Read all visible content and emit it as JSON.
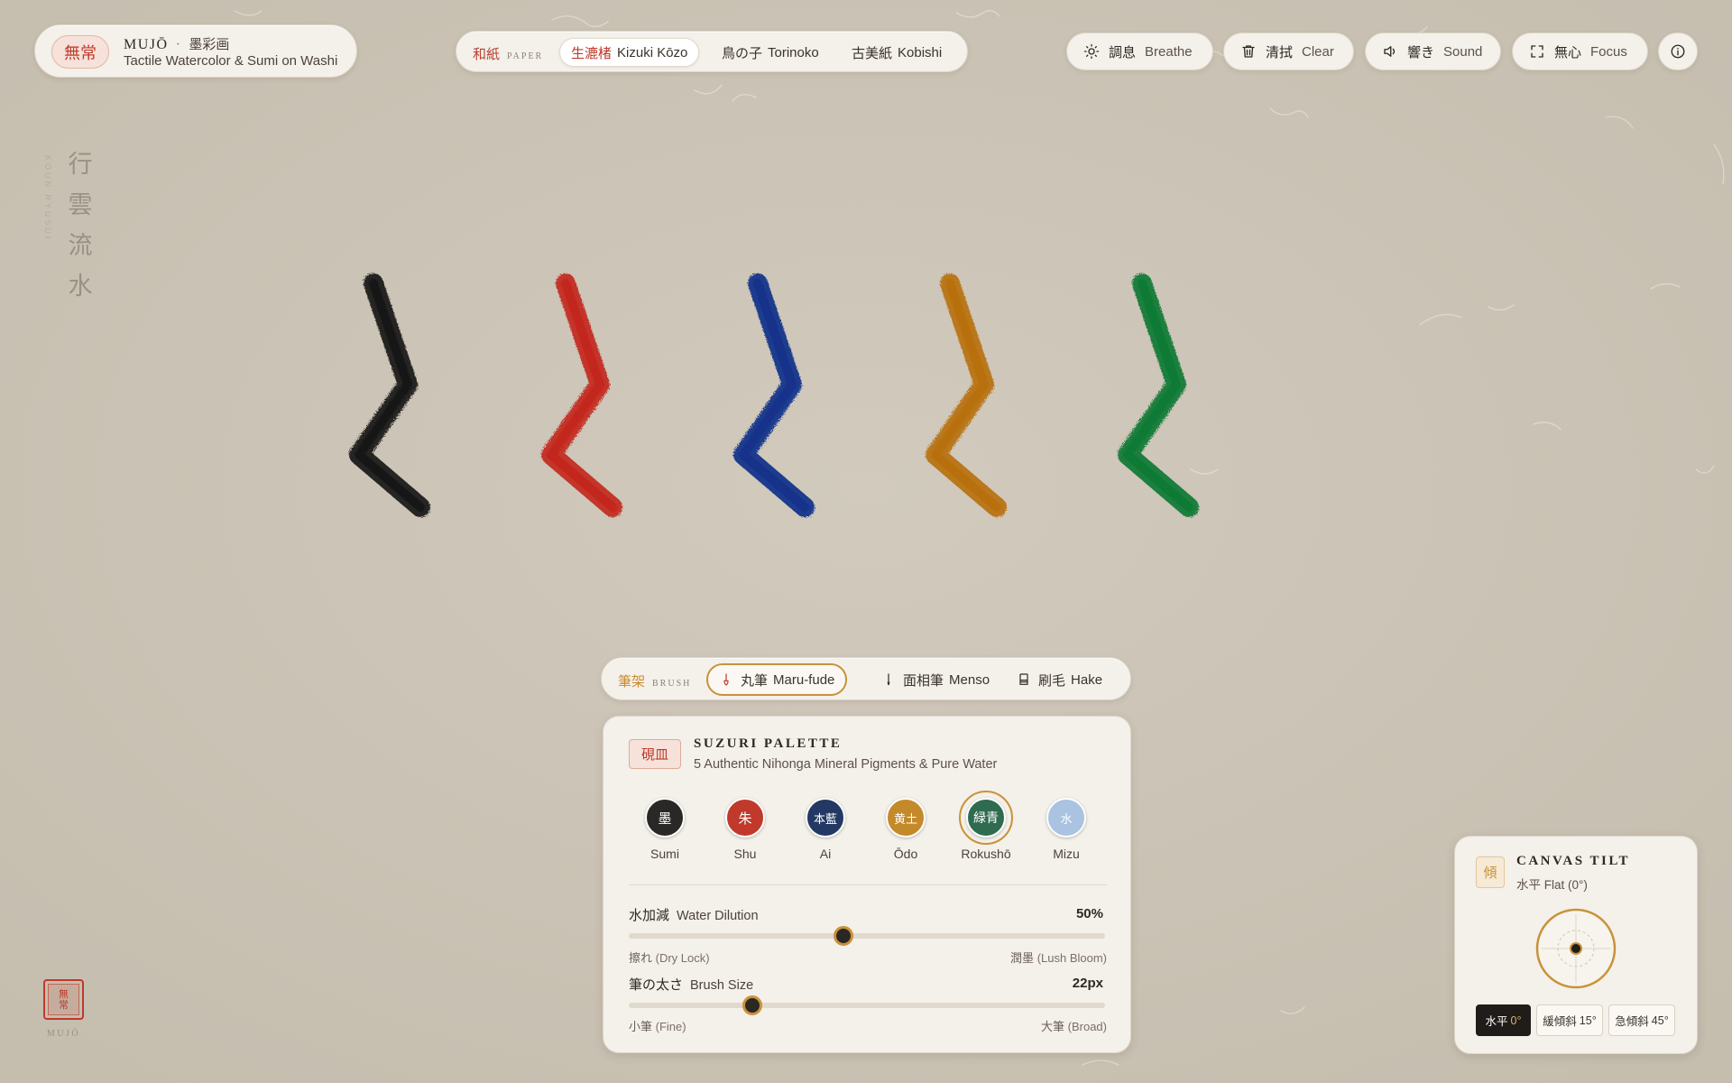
{
  "brand": {
    "seal": "無常",
    "title": "MUJŌ",
    "title_jp": "墨彩画",
    "subtitle": "Tactile Watercolor & Sumi on Washi"
  },
  "paper": {
    "tag_jp": "和紙",
    "tag_en": "PAPER",
    "options": [
      {
        "jp": "生漉楮",
        "en": "Kizuki Kōzo",
        "active": true
      },
      {
        "jp": "鳥の子",
        "en": "Torinoko",
        "active": false
      },
      {
        "jp": "古美紙",
        "en": "Kobishi",
        "active": false
      }
    ]
  },
  "actions": {
    "breathe": {
      "jp": "調息",
      "en": "Breathe",
      "icon": "sun-icon"
    },
    "clear": {
      "jp": "清拭",
      "en": "Clear",
      "icon": "trash-icon"
    },
    "sound": {
      "jp": "響き",
      "en": "Sound",
      "icon": "speaker-icon"
    },
    "focus": {
      "jp": "無心",
      "en": "Focus",
      "icon": "fullscreen-icon"
    },
    "info": {
      "icon": "info-icon"
    }
  },
  "poem": {
    "chars": [
      "行",
      "雲",
      "流",
      "水"
    ],
    "romaji": "KOUN RYUSUI"
  },
  "strokes": [
    {
      "pigment": "Sumi",
      "color": "#161616"
    },
    {
      "pigment": "Shu",
      "color": "#c3261b"
    },
    {
      "pigment": "Ai",
      "color": "#12308a"
    },
    {
      "pigment": "Ōdo",
      "color": "#b8700c"
    },
    {
      "pigment": "Rokushō",
      "color": "#0f7a34"
    }
  ],
  "brush": {
    "tag_jp": "筆架",
    "tag_en": "BRUSH",
    "options": [
      {
        "jp": "丸筆",
        "en": "Maru-fude",
        "icon": "round-brush-icon",
        "active": true
      },
      {
        "jp": "面相筆",
        "en": "Menso",
        "icon": "fine-brush-icon",
        "active": false
      },
      {
        "jp": "刷毛",
        "en": "Hake",
        "icon": "flat-brush-icon",
        "active": false
      }
    ]
  },
  "palette": {
    "badge": "硯皿",
    "title": "SUZURI PALETTE",
    "subtitle": "5 Authentic Nihonga Mineral Pigments & Pure Water",
    "swatches": [
      {
        "kanji": "墨",
        "name": "Sumi",
        "color": "#2a2827",
        "active": false
      },
      {
        "kanji": "朱",
        "name": "Shu",
        "color": "#c0392b",
        "active": false
      },
      {
        "kanji": "本藍",
        "name": "Ai",
        "color": "#233862",
        "active": false
      },
      {
        "kanji": "黄土",
        "name": "Ōdo",
        "color": "#c48a2a",
        "active": false
      },
      {
        "kanji": "緑青",
        "name": "Rokushō",
        "color": "#2f6b4f",
        "active": true
      },
      {
        "kanji": "水",
        "name": "Mizu",
        "color": "#a9c3e0",
        "active": false
      }
    ],
    "water": {
      "jp": "水加減",
      "en": "Water Dilution",
      "value": "50%",
      "level": 0.45,
      "min_jp": "擦れ",
      "min_en": "(Dry Lock)",
      "max_jp": "潤墨",
      "max_en": "(Lush Bloom)"
    },
    "size": {
      "jp": "筆の太さ",
      "en": "Brush Size",
      "value": "22px",
      "level": 0.26,
      "min_jp": "小筆",
      "min_en": "(Fine)",
      "max_jp": "大筆",
      "max_en": "(Broad)"
    }
  },
  "tilt": {
    "badge": "傾",
    "title": "CANVAS TILT",
    "status": "水平 Flat (0°)",
    "options": [
      {
        "jp": "水平",
        "deg": "0°",
        "active": true
      },
      {
        "jp": "緩傾斜",
        "deg": "15°",
        "active": false
      },
      {
        "jp": "急傾斜",
        "deg": "45°",
        "active": false
      }
    ]
  },
  "seal": {
    "top": "無",
    "bottom": "常",
    "caption": "MUJŌ"
  },
  "colors": {
    "background": "#ccc4b6",
    "accent_red": "#c0392b",
    "accent_gold": "#c8923a"
  }
}
